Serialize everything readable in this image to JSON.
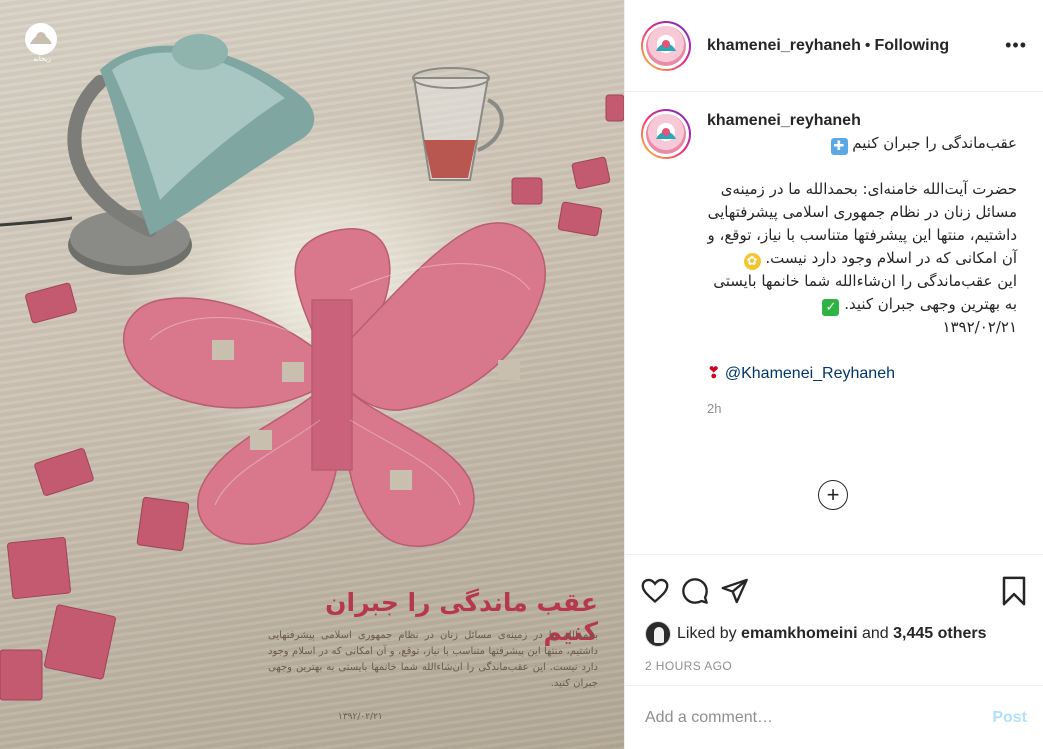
{
  "post": {
    "username": "khamenei_reyhaneh",
    "separator": "•",
    "follow_status": "Following",
    "more_label": "•••"
  },
  "media": {
    "logo_caption": "ریحانه",
    "poster_title": "عقب ماندگی را جبران کنیم",
    "poster_body": "بحمدالله ما در زمینه‌ی مسائل زنان در نظام جمهوری اسلامی پیشرفتهایی داشتیم، منتها این پیشرفتها متناسب با نیاز، توقع، و آن امکانی که در اسلام وجود دارد نیست. این عقب‌ماندگی را ان‌شاءالله شما خانمها بایستی به بهترین وجهی جبران کنید.",
    "poster_date": "۱۳۹۲/۰۲/۲۱"
  },
  "caption": {
    "username": "khamenei_reyhaneh",
    "title": "عقب‌ماندگی را جبران کنیم",
    "paragraph1": "حضرت آیت‌الله خامنه‌ای: بحمدالله ما در زمینه‌ی مسائل زنان در نظام جمهوری اسلامی پیشرفتهایی داشتیم، منتها این پیشرفتها متناسب با نیاز، توقع، و آن امکانی که در اسلام وجود دارد نیست.",
    "paragraph2": "این عقب‌ماندگی را ان‌شاءالله شما خانمها بایستی به بهترین وجهی جبران کنید.",
    "date": "۱۳۹۲/۰۲/۲۱",
    "mention": "@Khamenei_Reyhaneh",
    "age": "2h"
  },
  "actions": {
    "liked_by_prefix": "Liked by",
    "liked_by_user": "emamkhomeini",
    "liked_and": "and",
    "others_count": "3,445 others",
    "posted_time": "2 HOURS AGO"
  },
  "comment_input": {
    "placeholder": "Add a comment…",
    "post_label": "Post"
  },
  "icons": {
    "like": "heart-icon",
    "comment": "comment-bubble-icon",
    "share": "paper-plane-icon",
    "save": "bookmark-icon",
    "load_more": "plus-circle-icon"
  },
  "colors": {
    "text": "#262626",
    "muted": "#8e8e8e",
    "link": "#00376b",
    "post_disabled": "#b2dffc",
    "poster_title": "#b5384e",
    "butterfly": "#d9788c"
  }
}
